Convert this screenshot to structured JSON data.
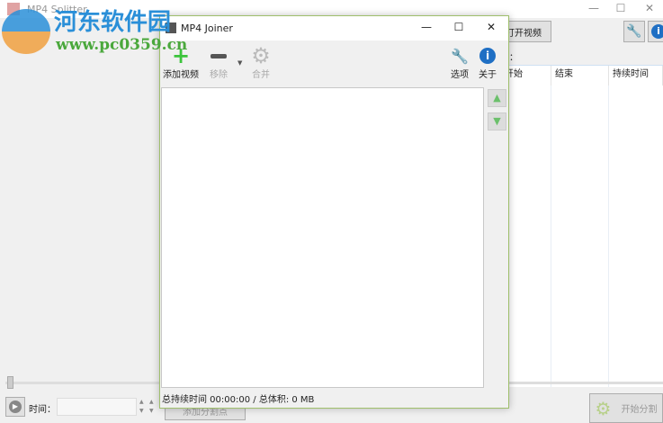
{
  "splitter": {
    "title": "MP4 Splitter",
    "open_video": "打开视频",
    "field_label": "：",
    "columns": [
      "开始",
      "结束",
      "持续时间"
    ],
    "time_label": "时间：",
    "time_value": "",
    "add_split": "添加分割点",
    "start_split": "开始分割",
    "slider_value": 0
  },
  "joiner": {
    "title": "MP4 Joiner",
    "toolbar": {
      "add": "添加视频",
      "remove": "移除",
      "merge": "合并",
      "options": "选项",
      "about": "关于"
    },
    "status": "总持续时间 00:00:00 / 总体积: 0 MB"
  },
  "watermark": {
    "name": "河东软件园",
    "url": "www.pc0359.cn"
  },
  "colors": {
    "accent": "#2a8fd8",
    "window_border": "#9fbf6c",
    "add_green": "#3cc43c"
  }
}
